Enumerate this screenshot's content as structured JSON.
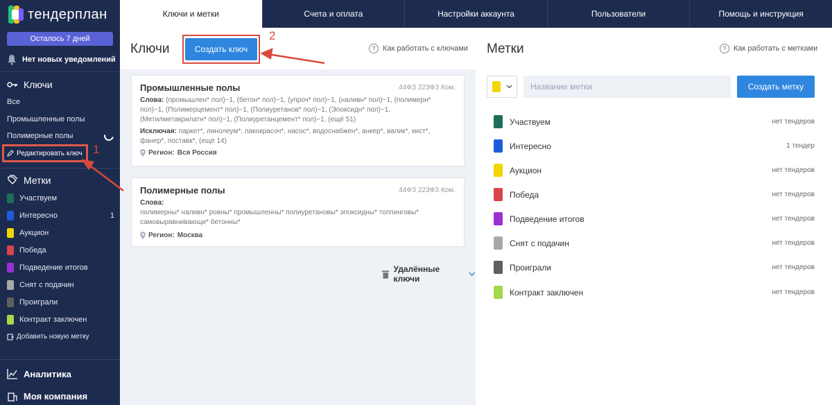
{
  "app": {
    "logo_text": "тендерплан",
    "trial_label": "Осталось 7 дней",
    "notifications": "Нет новых уведомлений"
  },
  "sidebar": {
    "keys_title": "Ключи",
    "key_items": [
      {
        "label": "Все"
      },
      {
        "label": "Промышленные полы"
      },
      {
        "label": "Полимерные полы"
      }
    ],
    "edit_key": "Редактировать ключ",
    "tags_title": "Метки",
    "tags": [
      {
        "label": "Участвуем",
        "color": "#1d6e5a",
        "count": ""
      },
      {
        "label": "Интересно",
        "color": "#1e5bd9",
        "count": "1"
      },
      {
        "label": "Аукцион",
        "color": "#f2d600",
        "count": ""
      },
      {
        "label": "Победа",
        "color": "#d9434a",
        "count": ""
      },
      {
        "label": "Подведение итогов",
        "color": "#9b2fd2",
        "count": ""
      },
      {
        "label": "Снят с подачин",
        "color": "#a8a8a8",
        "count": ""
      },
      {
        "label": "Проиграли",
        "color": "#5f5f5f",
        "count": ""
      },
      {
        "label": "Контракт заключен",
        "color": "#a3d94a",
        "count": ""
      }
    ],
    "add_tag": "Добавить новую метку",
    "analytics": "Аналитика",
    "company": "Моя компания"
  },
  "tabs": [
    {
      "label": "Ключи и метки",
      "active": true
    },
    {
      "label": "Счета и оплата",
      "active": false
    },
    {
      "label": "Настройки аккаунта",
      "active": false
    },
    {
      "label": "Пользователи",
      "active": false
    },
    {
      "label": "Помощь и инструкция",
      "active": false
    }
  ],
  "keys": {
    "title": "Ключи",
    "create_button": "Создать ключ",
    "help": "Как работать с ключами",
    "cards": [
      {
        "title": "Промышленные полы",
        "laws": "44ФЗ 223ФЗ Ком.",
        "words_label": "Слова:",
        "words": "(промышлен* пол)~1, (бетон* пол)~1, (упроч* пол)~1, (наливн* пол)~1, (полимерн* пол)~1, (Полимерцемент* пол)~1, (Полиуретанов* пол)~1, (Эпоксидн* пол)~1, (Метилметакрилатн* пол)~1, (Полиуретанцемент* пол)~1, (ещё 51)",
        "exclude_label": "Исключая:",
        "exclude": "паркет*, линолеум*, лакокрасоч*, насос*, водоснабжен*, анкер*, валик*, кист*, фанер*, поставк*, (ещё 14)",
        "region_label": "Регион:",
        "region": "Вся Россия"
      },
      {
        "title": "Полимерные полы",
        "laws": "44ФЗ 223ФЗ Ком.",
        "words_label": "Слова:",
        "words": "полимерны* наливн* ровны* промышленны* полиуретановы* эпоксидны* топпинговы* самовыравнивающи* бетонны*",
        "region_label": "Регион:",
        "region": "Москва"
      }
    ],
    "deleted_label": "Удалённые ключи"
  },
  "tags_panel": {
    "title": "Метки",
    "help": "Как работать с метками",
    "name_placeholder": "Название метки",
    "create_button": "Создать метку",
    "picker_color": "#f2d600",
    "tags": [
      {
        "label": "Участвуем",
        "color": "#1d6e5a",
        "count": "нет тендеров"
      },
      {
        "label": "Интересно",
        "color": "#1e5bd9",
        "count": "1 тендер"
      },
      {
        "label": "Аукцион",
        "color": "#f2d600",
        "count": "нет тендеров"
      },
      {
        "label": "Победа",
        "color": "#d9434a",
        "count": "нет тендеров"
      },
      {
        "label": "Подведение итогов",
        "color": "#9b2fd2",
        "count": "нет тендеров"
      },
      {
        "label": "Снят с подачин",
        "color": "#a8a8a8",
        "count": "нет тендеров"
      },
      {
        "label": "Проиграли",
        "color": "#5f5f5f",
        "count": "нет тендеров"
      },
      {
        "label": "Контракт заключен",
        "color": "#a3d94a",
        "count": "нет тендеров"
      }
    ]
  },
  "annotations": {
    "step1": "1",
    "step2": "2",
    "color": "#d94a3a"
  }
}
